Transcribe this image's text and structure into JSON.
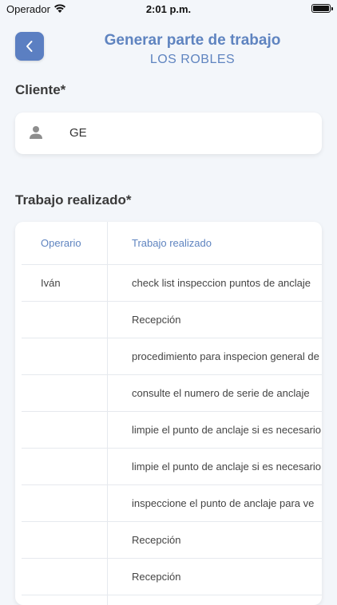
{
  "status": {
    "carrier": "Operador",
    "time": "2:01 p.m."
  },
  "header": {
    "title": "Generar parte de trabajo",
    "subtitle": "LOS ROBLES"
  },
  "client": {
    "label": "Cliente*",
    "value": "GE"
  },
  "work": {
    "label": "Trabajo realizado*",
    "columns": [
      "Operario",
      "Trabajo realizado"
    ],
    "rows": [
      {
        "operario": "Iván",
        "trabajo": "check list inspeccion puntos de anclaje"
      },
      {
        "operario": "",
        "trabajo": "Recepción"
      },
      {
        "operario": "",
        "trabajo": "procedimiento para inspecion general de"
      },
      {
        "operario": "",
        "trabajo": "consulte el numero de serie de anclaje"
      },
      {
        "operario": "",
        "trabajo": "limpie el punto de anclaje si es necesario"
      },
      {
        "operario": "",
        "trabajo": "limpie el punto de anclaje si es necesario"
      },
      {
        "operario": "",
        "trabajo": "inspeccione el punto de anclaje para ve"
      },
      {
        "operario": "",
        "trabajo": "Recepción"
      },
      {
        "operario": "",
        "trabajo": "Recepción"
      },
      {
        "operario": "",
        "trabajo": ""
      }
    ]
  },
  "colors": {
    "accent": "#5b7fc2",
    "background": "#f3f6fa"
  }
}
